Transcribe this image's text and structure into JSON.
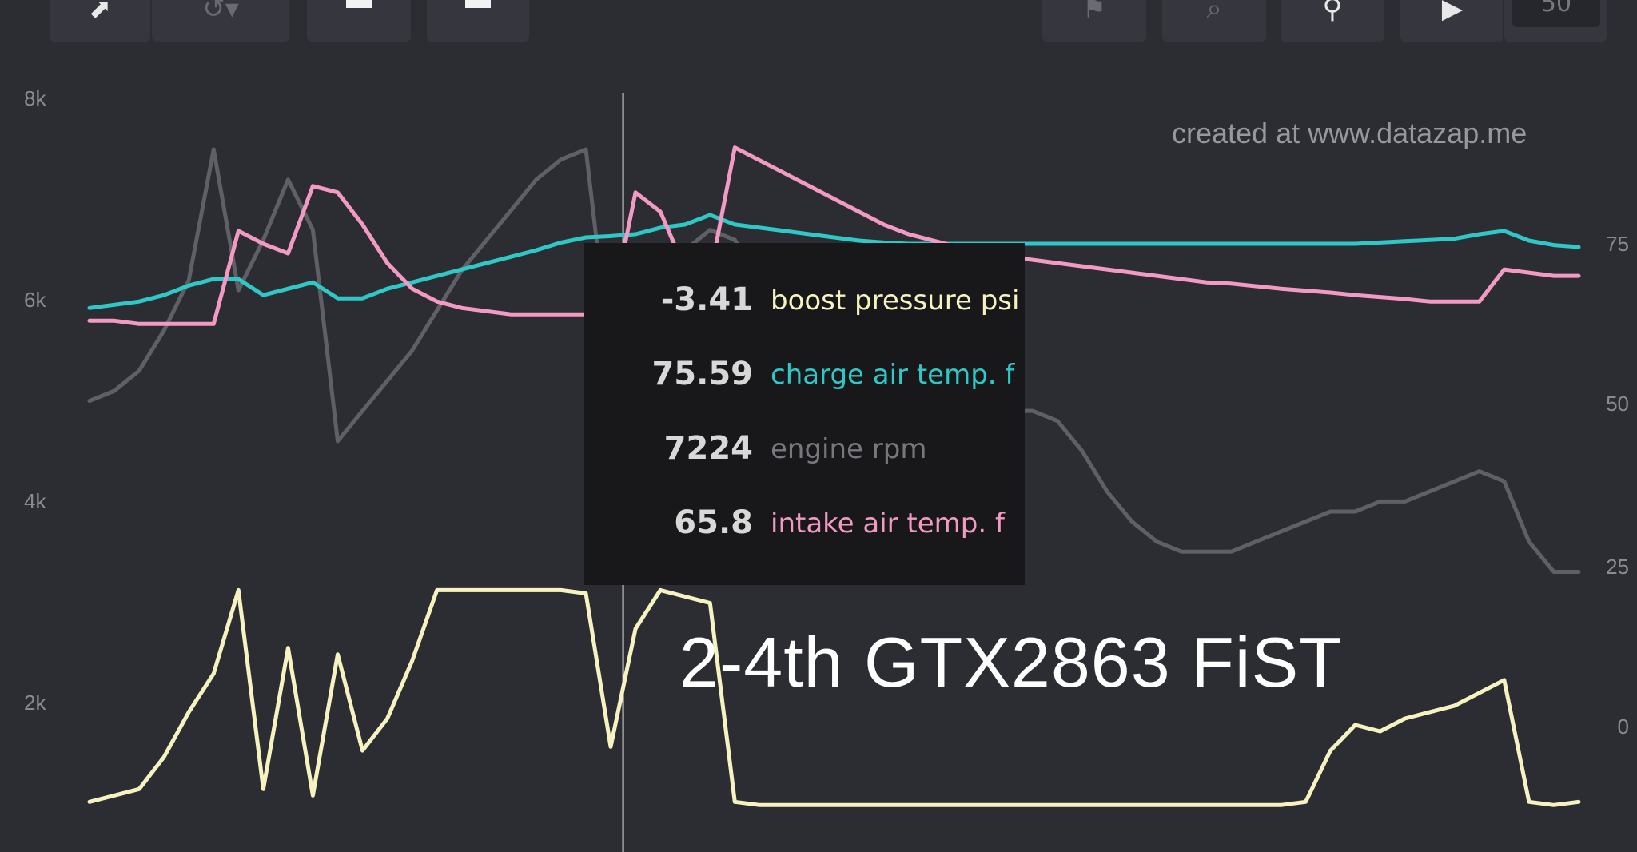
{
  "toolbar": {
    "buttons": [
      {
        "icon": "share-icon"
      },
      {
        "icon": "undo-icon"
      },
      {
        "icon": "panel-left-icon"
      },
      {
        "icon": "panel-right-icon"
      },
      {
        "icon": "flag-icon"
      },
      {
        "icon": "zoom-icon"
      },
      {
        "icon": "pin-icon"
      },
      {
        "icon": "play-icon"
      }
    ],
    "counter": "50"
  },
  "watermark": "created at www.datazap.me",
  "title": "2-4th GTX2863 FiST",
  "colors": {
    "background": "#2c2d33",
    "boost": "#f6f3c1",
    "charge": "#2ec9c7",
    "rpm": "#5f6065",
    "intake": "#f29ac3",
    "cursor": "#d8d8d8"
  },
  "tooltip": {
    "rows": [
      {
        "value": "-3.41",
        "name": "boost pressure psi",
        "color": "#f6f3c1"
      },
      {
        "value": "75.59",
        "name": "charge air temp. f",
        "color": "#2ec9c7"
      },
      {
        "value": "7224",
        "name": "engine rpm",
        "color": "#77787e"
      },
      {
        "value": "65.8",
        "name": "intake air temp. f",
        "color": "#f29ac3"
      }
    ]
  },
  "chart_data": {
    "type": "line",
    "title": "2-4th GTX2863 FiST",
    "grid": false,
    "legend": "tooltip",
    "cursor_x": 21.5,
    "x": [
      0,
      1,
      2,
      3,
      4,
      5,
      6,
      7,
      8,
      9,
      10,
      11,
      12,
      13,
      14,
      15,
      16,
      17,
      18,
      19,
      20,
      21,
      22,
      23,
      24,
      25,
      26,
      27,
      28,
      29,
      30,
      31,
      32,
      33,
      34,
      35,
      36,
      37,
      38,
      39,
      40,
      41,
      42,
      43,
      44,
      45,
      46,
      47,
      48,
      49,
      50,
      51,
      52,
      53,
      54,
      55,
      56,
      57,
      58,
      59,
      60
    ],
    "axes": {
      "left": {
        "ticks": [
          "2k",
          "4k",
          "6k",
          "8k"
        ],
        "range": [
          0,
          8000
        ]
      },
      "right": {
        "ticks": [
          "0",
          "25",
          "50",
          "75"
        ],
        "range": [
          -14,
          92
        ]
      }
    },
    "series": [
      {
        "name": "engine rpm",
        "axis": "left",
        "color": "#5f6065",
        "values": [
          5000,
          5100,
          5300,
          5700,
          6200,
          7500,
          6100,
          6600,
          7200,
          6700,
          4600,
          4900,
          5200,
          5500,
          5900,
          6300,
          6600,
          6900,
          7200,
          7400,
          7500,
          5400,
          5700,
          6100,
          6500,
          6700,
          6600,
          6200,
          5900,
          5600,
          5400,
          5200,
          5000,
          4900,
          4900,
          4900,
          4900,
          4900,
          4900,
          4800,
          4500,
          4100,
          3800,
          3600,
          3500,
          3500,
          3500,
          3600,
          3700,
          3800,
          3900,
          3900,
          4000,
          4000,
          4100,
          4200,
          4300,
          4200,
          3600,
          3300,
          3300
        ]
      },
      {
        "name": "charge air temp. f",
        "axis": "right",
        "color": "#2ec9c7",
        "values": [
          65,
          65.5,
          66,
          67,
          68.5,
          69.5,
          69.5,
          67,
          68,
          69,
          66.5,
          66.5,
          68,
          69,
          70,
          71,
          72,
          73,
          74,
          75.2,
          76,
          76.2,
          76.5,
          77.5,
          78,
          79.5,
          78,
          77.5,
          77,
          76.5,
          76,
          75.5,
          75.2,
          75,
          75,
          75,
          75,
          75,
          75,
          75,
          75,
          75,
          75,
          75,
          75,
          75,
          75,
          75,
          75,
          75,
          75,
          75,
          75.2,
          75.4,
          75.6,
          75.8,
          76.5,
          77,
          75.5,
          74.8,
          74.5
        ]
      },
      {
        "name": "intake air temp. f",
        "axis": "right",
        "color": "#f29ac3",
        "values": [
          63,
          63,
          62.5,
          62.5,
          62.5,
          62.5,
          77,
          75,
          73.5,
          84,
          83,
          78,
          72,
          68,
          66,
          65,
          64.5,
          64,
          64,
          64,
          64,
          64,
          83,
          80,
          71,
          70,
          90,
          88,
          86,
          84,
          82,
          80,
          78,
          76.5,
          75.5,
          74.5,
          73.5,
          73,
          72.5,
          72,
          71.5,
          71,
          70.5,
          70,
          69.5,
          69,
          68.8,
          68.4,
          68,
          67.7,
          67.4,
          67,
          66.7,
          66.4,
          66,
          66,
          66,
          71,
          70.5,
          70,
          70
        ]
      },
      {
        "name": "boost pressure psi",
        "axis": "right",
        "color": "#f6f3c1",
        "values": [
          -12,
          -11,
          -10,
          -5,
          2,
          8,
          21,
          -10,
          12,
          -11,
          11,
          -4,
          1,
          10,
          21,
          21,
          21,
          21,
          21,
          21,
          20.5,
          -3.41,
          15,
          21,
          20,
          19,
          -12,
          -12.5,
          -12.5,
          -12.5,
          -12.5,
          -12.5,
          -12.5,
          -12.5,
          -12.5,
          -12.5,
          -12.5,
          -12.5,
          -12.5,
          -12.5,
          -12.5,
          -12.5,
          -12.5,
          -12.5,
          -12.5,
          -12.5,
          -12.5,
          -12.5,
          -12.5,
          -12,
          -4,
          0,
          -1,
          1,
          2,
          3,
          5,
          7,
          -12,
          -12.5,
          -12
        ]
      }
    ]
  }
}
